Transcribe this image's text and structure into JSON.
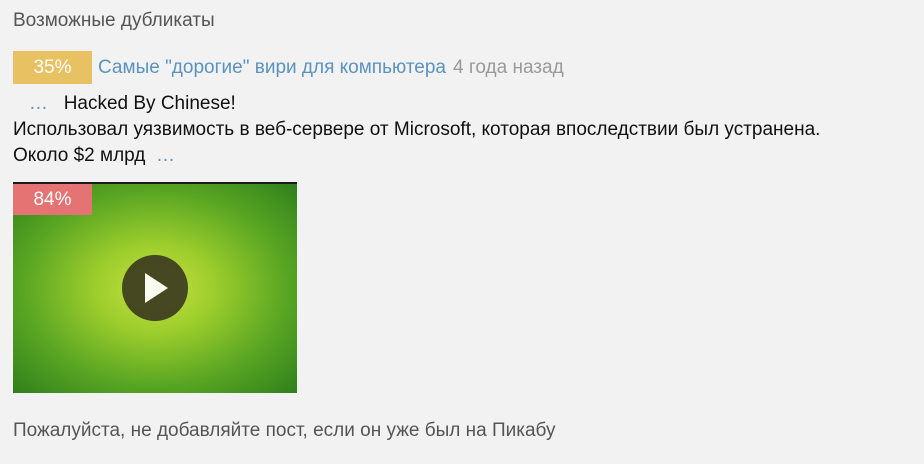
{
  "section": {
    "title": "Возможные дубликаты"
  },
  "duplicates": [
    {
      "match": "35%",
      "match_color": "#e8c262",
      "title": "Самые \"дорогие\" вири для компьютера",
      "time": "4 года назад",
      "snippet": {
        "lead_ellipsis": "…",
        "line1": "Hacked By Chinese!",
        "line2": "Использовал уязвимость в веб-сервере от Microsoft, которая впоследствии был устранена.",
        "line3": "Около $2 млрд",
        "trail_ellipsis": "…"
      }
    },
    {
      "match": "84%",
      "match_color": "#e57373",
      "media": "video",
      "icon": "play-icon"
    }
  ],
  "notice": "Пожалуйста, не добавляйте пост, если он уже был на Пикабу"
}
